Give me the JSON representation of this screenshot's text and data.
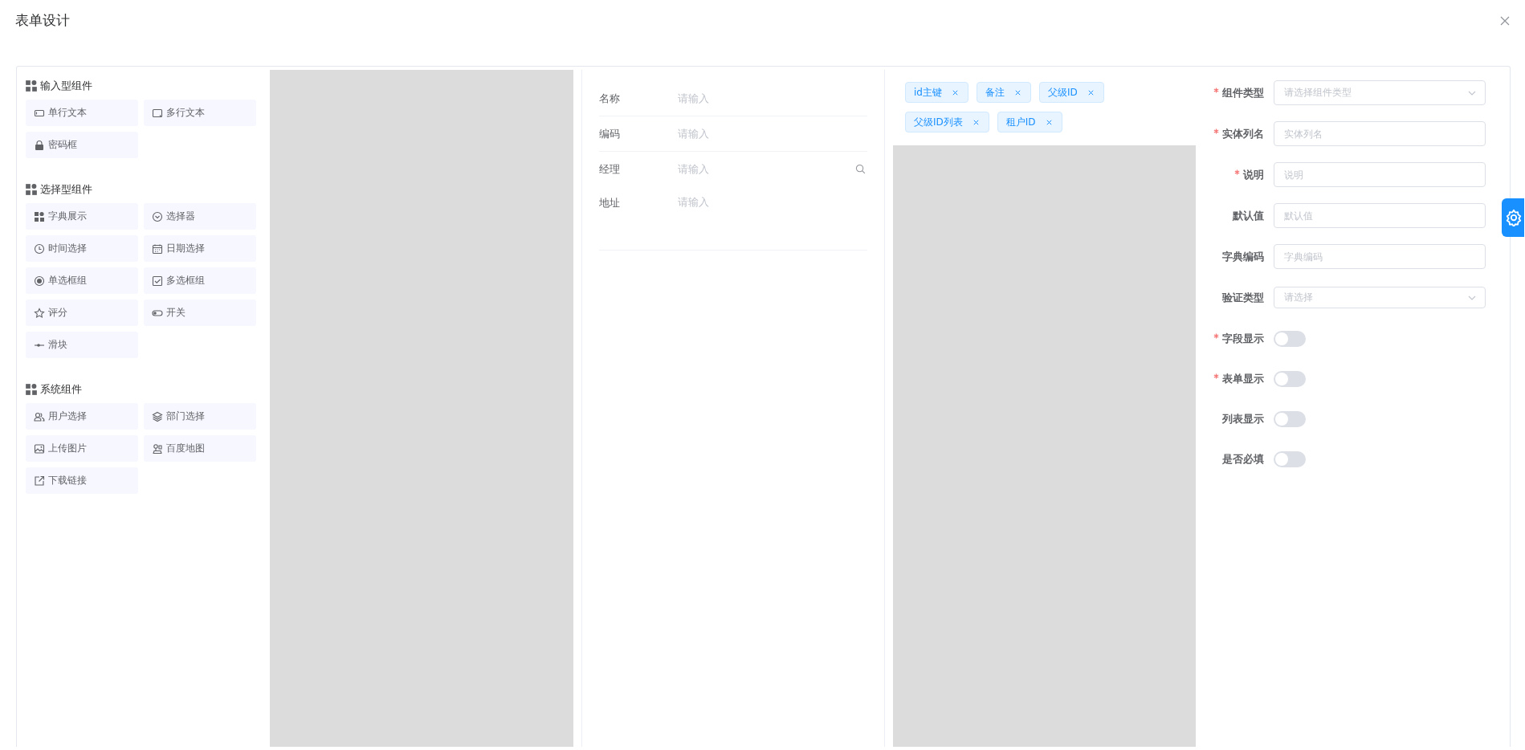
{
  "dialog": {
    "title": "表单设计"
  },
  "palette": [
    {
      "title": "输入型组件",
      "items": [
        {
          "label": "单行文本",
          "kind": "input"
        },
        {
          "label": "多行文本",
          "kind": "textarea"
        },
        {
          "label": "密码框",
          "kind": "lock"
        }
      ]
    },
    {
      "title": "选择型组件",
      "items": [
        {
          "label": "字典展示",
          "kind": "grid"
        },
        {
          "label": "选择器",
          "kind": "select"
        },
        {
          "label": "时间选择",
          "kind": "clock"
        },
        {
          "label": "日期选择",
          "kind": "calendar"
        },
        {
          "label": "单选框组",
          "kind": "radio"
        },
        {
          "label": "多选框组",
          "kind": "checkbox"
        },
        {
          "label": "评分",
          "kind": "star"
        },
        {
          "label": "开关",
          "kind": "switch"
        },
        {
          "label": "滑块",
          "kind": "slider"
        }
      ]
    },
    {
      "title": "系统组件",
      "items": [
        {
          "label": "用户选择",
          "kind": "users"
        },
        {
          "label": "部门选择",
          "kind": "layers"
        },
        {
          "label": "上传图片",
          "kind": "image"
        },
        {
          "label": "百度地图",
          "kind": "map"
        },
        {
          "label": "下载链接",
          "kind": "link"
        }
      ]
    }
  ],
  "preview_fields": [
    {
      "label": "名称",
      "placeholder": "请输入",
      "kind": "input"
    },
    {
      "label": "编码",
      "placeholder": "请输入",
      "kind": "input"
    },
    {
      "label": "经理",
      "placeholder": "请输入",
      "kind": "search"
    },
    {
      "label": "地址",
      "placeholder": "请输入",
      "kind": "textarea"
    }
  ],
  "field_tags": [
    {
      "label": "id主键"
    },
    {
      "label": "备注"
    },
    {
      "label": "父级ID"
    },
    {
      "label": "父级ID列表"
    },
    {
      "label": "租户ID"
    }
  ],
  "properties": [
    {
      "kind": "select",
      "label": "组件类型",
      "required": true,
      "placeholder": "请选择组件类型"
    },
    {
      "kind": "input",
      "label": "实体列名",
      "required": true,
      "placeholder": "实体列名"
    },
    {
      "kind": "input",
      "label": "说明",
      "required": true,
      "placeholder": "说明"
    },
    {
      "kind": "input",
      "label": "默认值",
      "required": false,
      "placeholder": "默认值"
    },
    {
      "kind": "input",
      "label": "字典编码",
      "required": false,
      "placeholder": "字典编码"
    },
    {
      "kind": "select",
      "label": "验证类型",
      "required": false,
      "placeholder": "请选择"
    },
    {
      "kind": "switch",
      "label": "字段显示",
      "required": true,
      "on": false
    },
    {
      "kind": "switch",
      "label": "表单显示",
      "required": true,
      "on": false
    },
    {
      "kind": "switch",
      "label": "列表显示",
      "required": false,
      "on": false
    },
    {
      "kind": "switch",
      "label": "是否必填",
      "required": false,
      "on": false
    }
  ]
}
